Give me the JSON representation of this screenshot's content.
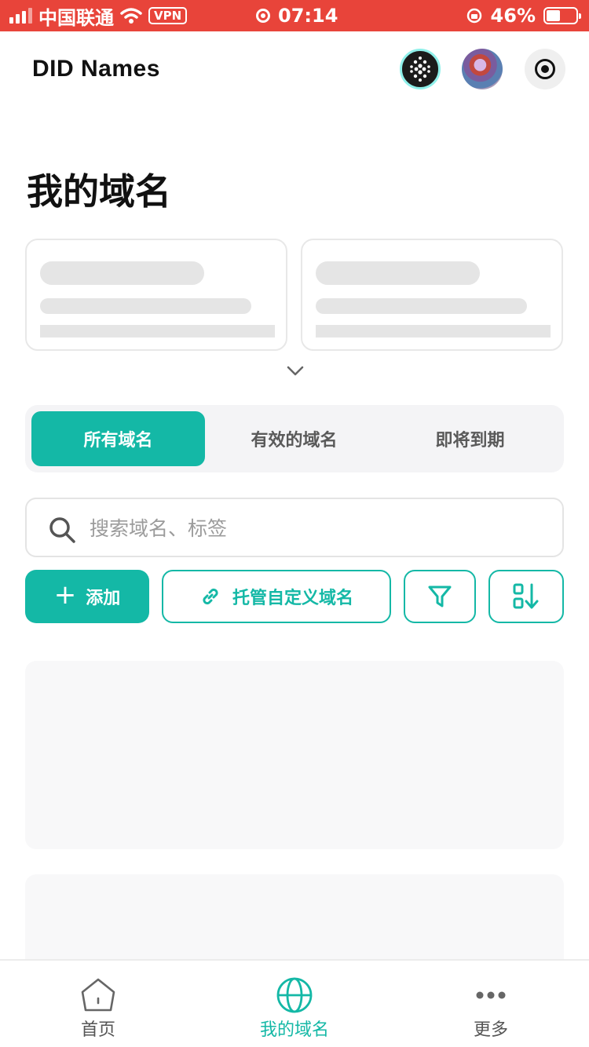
{
  "status_bar": {
    "carrier": "中国联通",
    "vpn": "VPN",
    "time": "07:14",
    "battery": "46%",
    "battery_level": 0.46
  },
  "header": {
    "title": "DID Names"
  },
  "page": {
    "title": "我的域名"
  },
  "tabs": [
    {
      "label": "所有域名",
      "active": true
    },
    {
      "label": "有效的域名",
      "active": false
    },
    {
      "label": "即将到期",
      "active": false
    }
  ],
  "search": {
    "placeholder": "搜索域名、标签",
    "value": ""
  },
  "actions": {
    "add_label": "添加",
    "host_label": "托管自定义域名"
  },
  "bottom_nav": [
    {
      "label": "首页",
      "icon": "home-icon",
      "active": false
    },
    {
      "label": "我的域名",
      "icon": "globe-icon",
      "active": true
    },
    {
      "label": "更多",
      "icon": "more-icon",
      "active": false
    }
  ],
  "colors": {
    "accent": "#14b8a6",
    "status_bar": "#e8443a"
  }
}
